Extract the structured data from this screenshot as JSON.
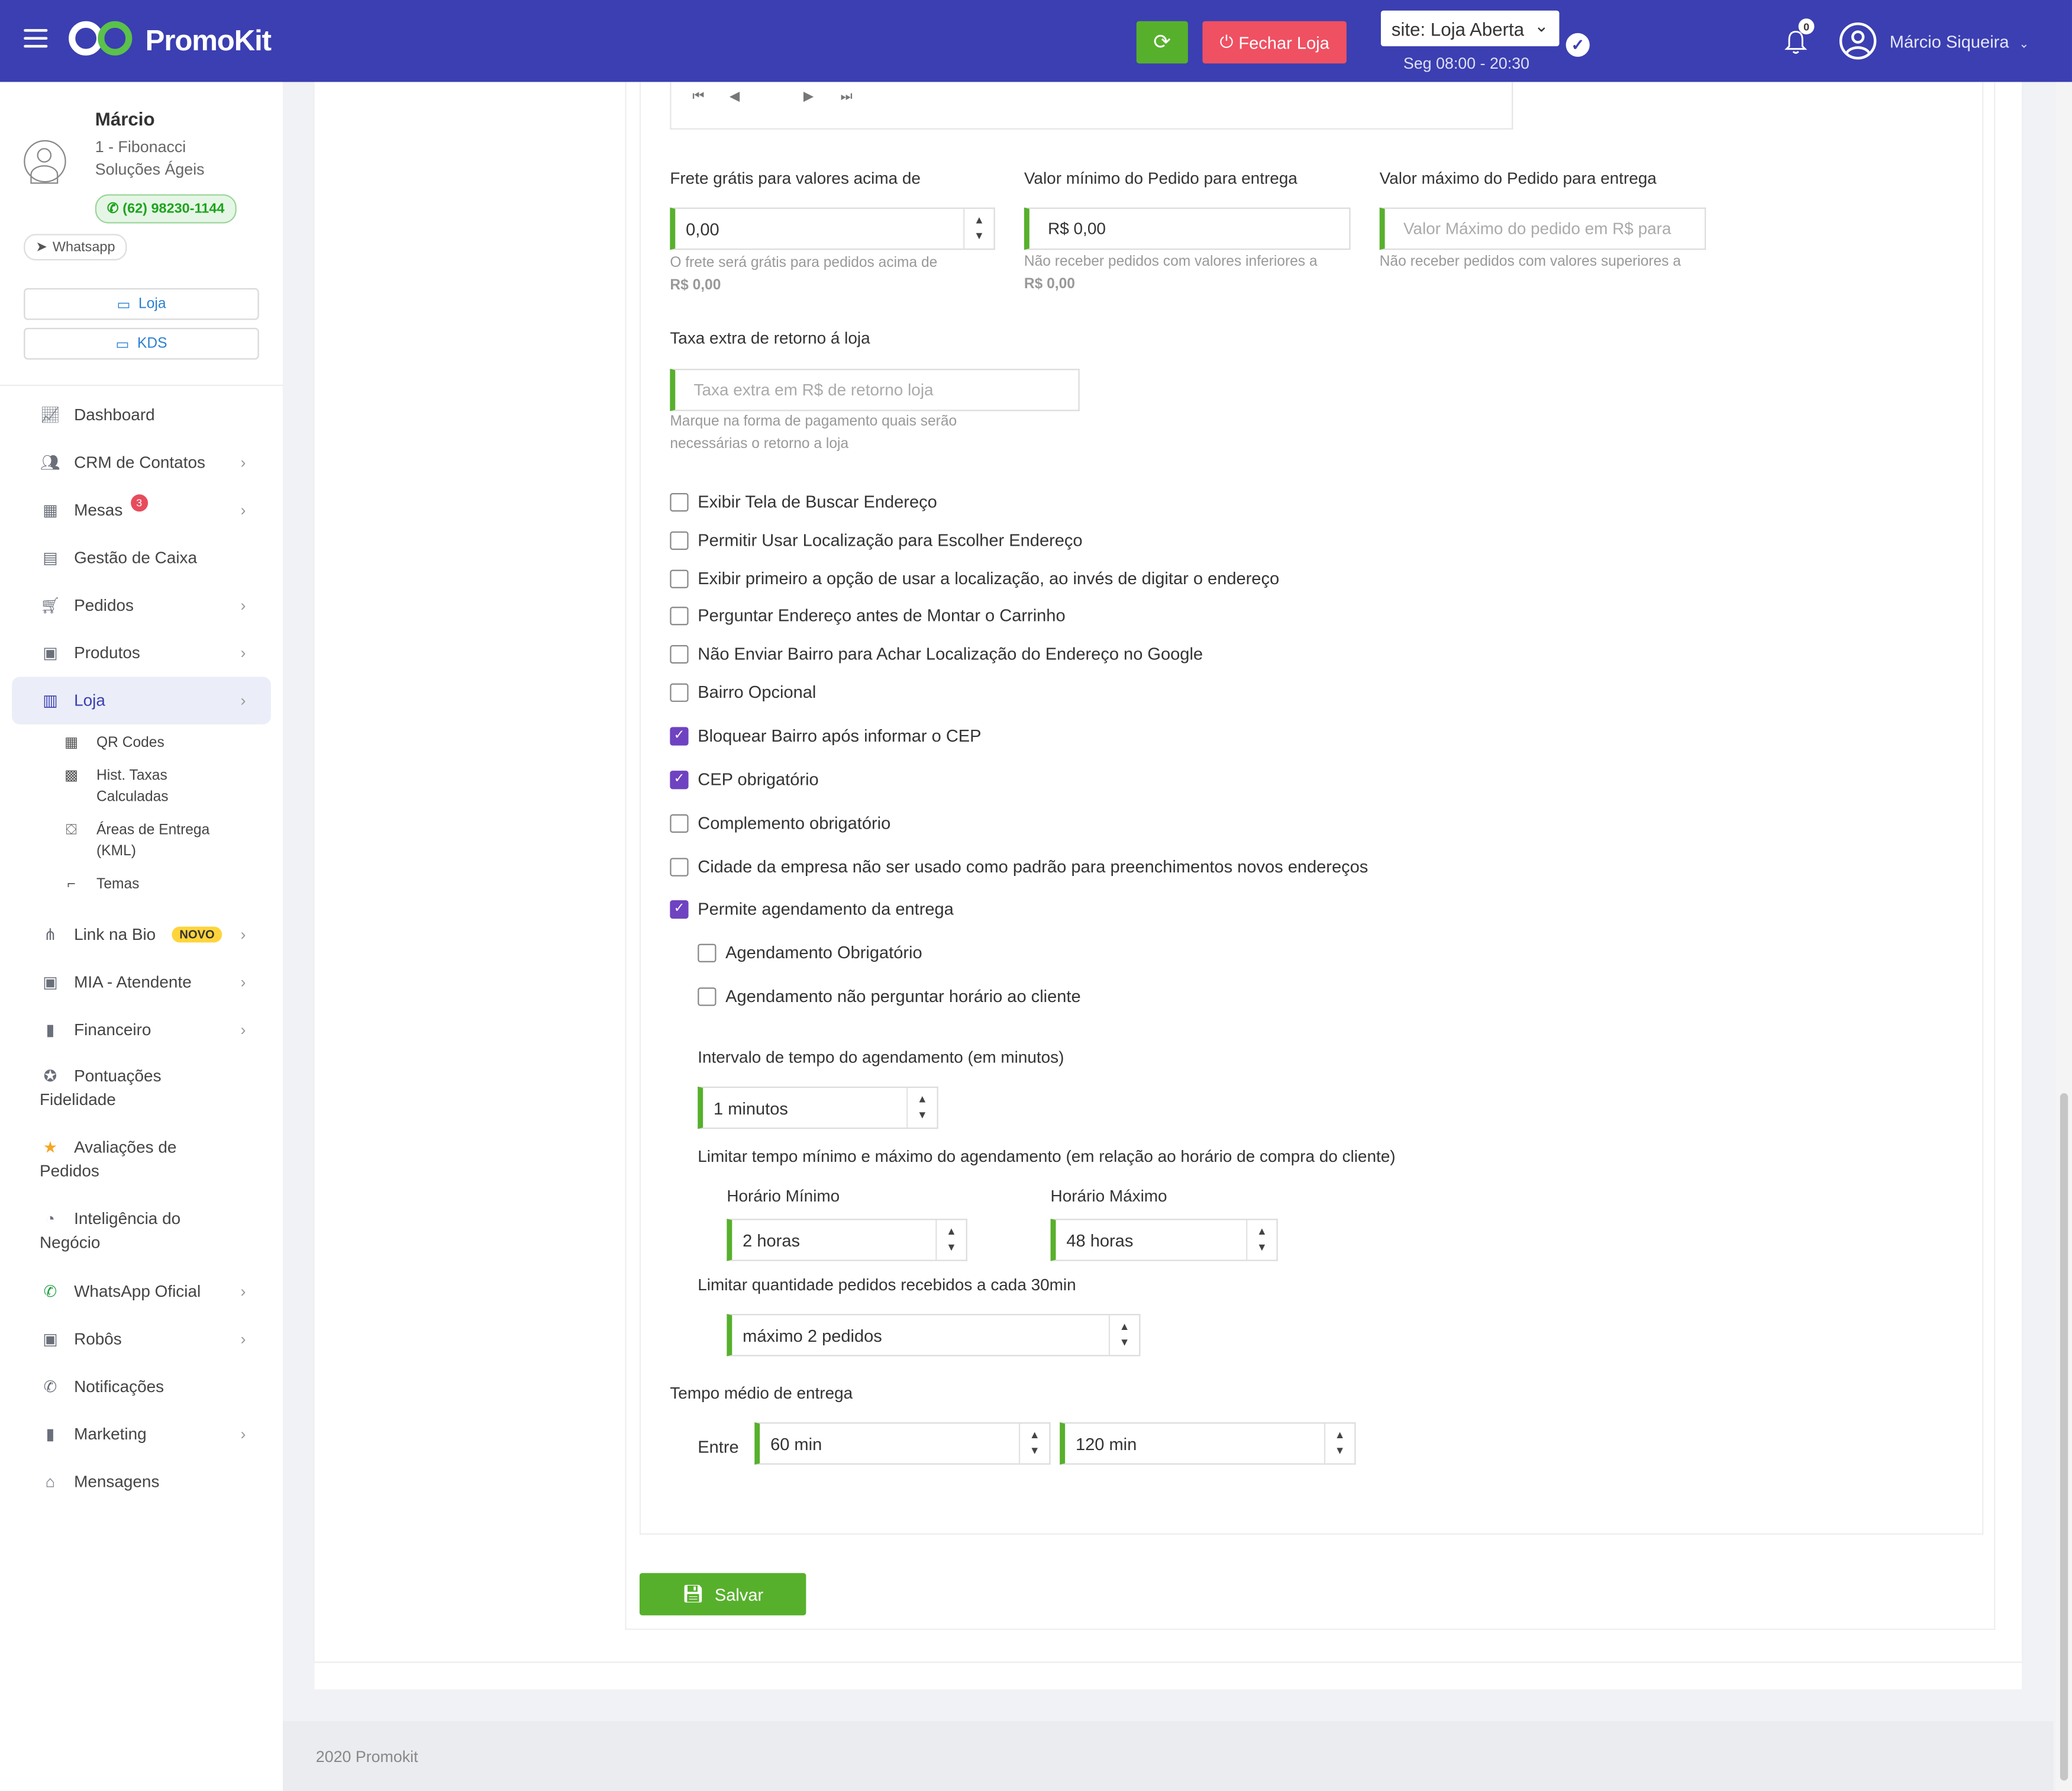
{
  "app": {
    "logo_text": "PromoKit"
  },
  "topbar": {
    "close_store_label": "Fechar Loja",
    "site_status": "site: Loja Aberta",
    "site_hours": "Seg 08:00 - 20:30",
    "notification_count": "0",
    "user_name": "Márcio Siqueira",
    "colors": {
      "bar": "#3b3fb1",
      "refresh": "#57b02c",
      "close": "#ef5062"
    }
  },
  "profile": {
    "name": "Márcio",
    "company": "1 - Fibonacci Soluções Ágeis",
    "phone": "(62) 98230-1144",
    "whatsapp_label": "Whatsapp",
    "store_button": "Loja",
    "kds_button": "KDS"
  },
  "sidebar": {
    "items": [
      {
        "label": "Dashboard",
        "icon": "chart-line-icon"
      },
      {
        "label": "CRM de Contatos",
        "icon": "users-icon",
        "arrow": true
      },
      {
        "label": "Mesas",
        "icon": "table-icon",
        "arrow": true,
        "badge": "3"
      },
      {
        "label": "Gestão de Caixa",
        "icon": "cash-register-icon"
      },
      {
        "label": "Pedidos",
        "icon": "cart-icon",
        "arrow": true
      },
      {
        "label": "Produtos",
        "icon": "boxes-icon",
        "arrow": true
      },
      {
        "label": "Loja",
        "icon": "building-icon",
        "arrow": true,
        "active": true
      }
    ],
    "sub_items": [
      {
        "label": "QR Codes",
        "icon": "qrcode-icon"
      },
      {
        "label": "Hist. Taxas Calculadas",
        "icon": "calculator-icon"
      },
      {
        "label": "Áreas de Entrega (KML)",
        "icon": "map-icon"
      },
      {
        "label": "Temas",
        "icon": "paint-roller-icon"
      }
    ],
    "items2": [
      {
        "label": "Link na Bio",
        "icon": "sitemap-icon",
        "arrow": true,
        "novo": "NOVO"
      },
      {
        "label": "MIA - Atendente",
        "icon": "robot-icon",
        "arrow": true
      },
      {
        "label": "Financeiro",
        "icon": "bar-chart-icon",
        "arrow": true
      },
      {
        "label": "Pontuações Fidelidade",
        "icon": "medal-icon",
        "two_line": true
      },
      {
        "label": "Avaliações de Pedidos",
        "icon": "star-icon",
        "two_line": true
      },
      {
        "label": "Inteligência do Negócio",
        "icon": "pie-chart-icon",
        "two_line": true
      },
      {
        "label": "WhatsApp Oficial",
        "icon": "whatsapp-icon",
        "arrow": true
      },
      {
        "label": "Robôs",
        "icon": "robot-icon",
        "arrow": true
      },
      {
        "label": "Notificações",
        "icon": "whatsapp-icon"
      },
      {
        "label": "Marketing",
        "icon": "bar-chart-icon",
        "arrow": true
      },
      {
        "label": "Mensagens",
        "icon": "inbox-icon"
      }
    ]
  },
  "form": {
    "free_shipping": {
      "label": "Frete grátis para valores acima de",
      "value": "0,00",
      "hint": "O frete será grátis para pedidos acima de",
      "hint_value": "R$ 0,00"
    },
    "min_order": {
      "label": "Valor mínimo do Pedido para entrega",
      "value": "R$ 0,00",
      "hint": "Não receber pedidos com valores inferiores a",
      "hint_value": "R$ 0,00"
    },
    "max_order": {
      "label": "Valor máximo do Pedido para entrega",
      "placeholder": "Valor Máximo do pedido em R$ para",
      "hint": "Não receber pedidos com valores superiores a"
    },
    "return_fee": {
      "label": "Taxa extra de retorno á loja",
      "placeholder": "Taxa extra em R$ de retorno loja",
      "hint": "Marque na forma de pagamento quais serão necessárias o retorno a loja"
    },
    "checks": [
      {
        "label": "Exibir Tela de Buscar Endereço",
        "checked": false
      },
      {
        "label": "Permitir Usar Localização para Escolher Endereço",
        "checked": false
      },
      {
        "label": "Exibir primeiro a opção de usar a localização, ao invés de digitar o endereço",
        "checked": false
      },
      {
        "label": "Perguntar Endereço antes de Montar o Carrinho",
        "checked": false
      },
      {
        "label": "Não Enviar Bairro para Achar Localização do Endereço no Google",
        "checked": false
      },
      {
        "label": "Bairro Opcional",
        "checked": false
      },
      {
        "label": "Bloquear Bairro após informar o CEP",
        "checked": true
      },
      {
        "label": "CEP obrigatório",
        "checked": true
      },
      {
        "label": "Complemento obrigatório",
        "checked": false
      },
      {
        "label": "Cidade da empresa não ser usado como padrão para preenchimentos novos endereços",
        "checked": false
      },
      {
        "label": "Permite agendamento da entrega",
        "checked": true
      }
    ],
    "sched_mandatory": {
      "label": "Agendamento Obrigatório",
      "checked": false
    },
    "sched_no_time": {
      "label": "Agendamento não perguntar horário ao cliente",
      "checked": false
    },
    "interval": {
      "label": "Intervalo de tempo do agendamento (em minutos)",
      "value": "1 minutos"
    },
    "limit_time": {
      "label": "Limitar tempo mínimo e máximo do agendamento (em relação ao horário de compra do cliente)"
    },
    "min_time": {
      "label": "Horário Mínimo",
      "value": "2 horas"
    },
    "max_time": {
      "label": "Horário Máximo",
      "value": "48 horas"
    },
    "limit_qty": {
      "label": "Limitar quantidade pedidos recebidos a cada 30min",
      "value": "máximo 2 pedidos"
    },
    "avg_time": {
      "label": "Tempo médio de entrega",
      "between": "Entre",
      "from": "60 min",
      "to": "120 min"
    },
    "save_label": "Salvar"
  },
  "footer": {
    "text": "2020 Promokit"
  }
}
